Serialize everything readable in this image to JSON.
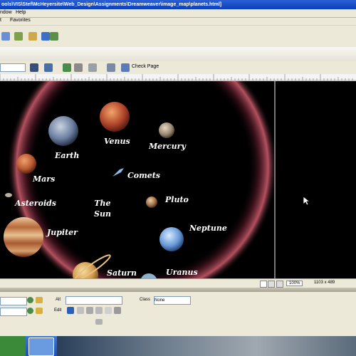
{
  "window": {
    "title": "ools\\VIS\\Stef\\McHeyersite\\Web_Design\\Assignments\\Dreamweaver\\image_map\\planets.html]"
  },
  "menu": {
    "items": [
      "ndow",
      "Help"
    ]
  },
  "subbar": {
    "items": [
      "t",
      "Favorites"
    ]
  },
  "docbar": {
    "check_page": "Check Page"
  },
  "canvas": {
    "labels": {
      "venus": "Venus",
      "mercury": "Mercury",
      "earth": "Earth",
      "comets": "Comets",
      "mars": "Mars",
      "pluto": "Pluto",
      "asteroids": "Asteroids",
      "the_sun": "The\nSun",
      "jupiter": "Jupiter",
      "neptune": "Neptune",
      "saturn": "Saturn",
      "uranus": "Uranus"
    }
  },
  "status": {
    "zoom": "100%",
    "size": "1103 x 489"
  },
  "properties": {
    "alt_label": "Alt",
    "class_label": "Class",
    "class_value": "None",
    "edit_label": "Edit"
  },
  "colors": {
    "titlebar": "#0a3fb8",
    "chrome": "#ece9d8",
    "taskbar": "#1f4fb5"
  }
}
